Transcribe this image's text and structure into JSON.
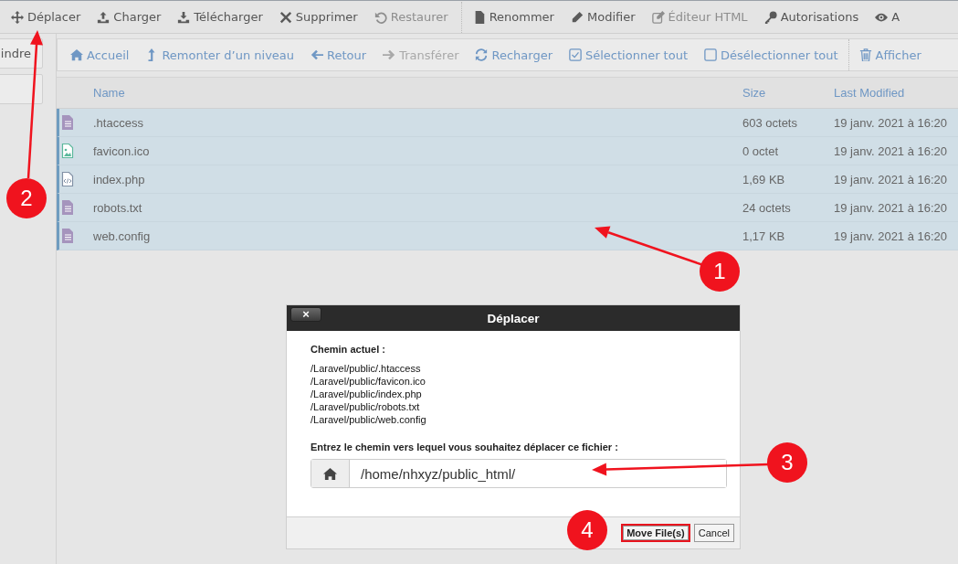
{
  "toolbar": [
    {
      "label": "Déplacer",
      "disabled": false
    },
    {
      "label": "Charger",
      "disabled": false
    },
    {
      "label": "Télécharger",
      "disabled": false
    },
    {
      "label": "Supprimer",
      "disabled": false
    },
    {
      "label": "Restaurer",
      "disabled": true
    },
    {
      "label": "Renommer",
      "disabled": false
    },
    {
      "label": "Modifier",
      "disabled": false
    },
    {
      "label": "Éditeur HTML",
      "disabled": true
    },
    {
      "label": "Autorisations",
      "disabled": false
    },
    {
      "label": "A",
      "disabled": false
    }
  ],
  "sidebar": {
    "buttons": [
      "indre"
    ]
  },
  "nav_toolbar": [
    {
      "label": "Accueil",
      "disabled": false
    },
    {
      "label": "Remonter d’un niveau",
      "disabled": false
    },
    {
      "label": "Retour",
      "disabled": false
    },
    {
      "label": "Transférer",
      "disabled": true
    },
    {
      "label": "Recharger",
      "disabled": false
    },
    {
      "label": "Sélectionner tout",
      "disabled": false
    },
    {
      "label": "Désélectionner tout",
      "disabled": false
    },
    {
      "label": "Afficher",
      "disabled": false
    }
  ],
  "table": {
    "columns": [
      "Name",
      "Size",
      "Last Modified"
    ],
    "rows": [
      {
        "kind": "text",
        "name": ".htaccess",
        "size": "603 octets",
        "modified": "19 janv. 2021 à 16:20",
        "selected": true
      },
      {
        "kind": "image",
        "name": "favicon.ico",
        "size": "0 octet",
        "modified": "19 janv. 2021 à 16:20",
        "selected": true
      },
      {
        "kind": "code",
        "name": "index.php",
        "size": "1,69 KB",
        "modified": "19 janv. 2021 à 16:20",
        "selected": true
      },
      {
        "kind": "text",
        "name": "robots.txt",
        "size": "24 octets",
        "modified": "19 janv. 2021 à 16:20",
        "selected": true
      },
      {
        "kind": "text",
        "name": "web.config",
        "size": "1,17 KB",
        "modified": "19 janv. 2021 à 16:20",
        "selected": true
      }
    ]
  },
  "dialog": {
    "title": "Déplacer",
    "close": "×",
    "current_label": "Chemin actuel :",
    "paths": [
      "/Laravel/public/.htaccess",
      "/Laravel/public/favicon.ico",
      "/Laravel/public/index.php",
      "/Laravel/public/robots.txt",
      "/Laravel/public/web.config"
    ],
    "target_label": "Entrez le chemin vers lequel vous souhaitez déplacer ce fichier :",
    "target_value": "/home/nhxyz/public_html/",
    "buttons": [
      {
        "label": "Move File(s)",
        "primary": true,
        "highlighted": true
      },
      {
        "label": "Cancel",
        "primary": false,
        "highlighted": false
      }
    ]
  },
  "annotations": [
    {
      "label": "1"
    },
    {
      "label": "2"
    },
    {
      "label": "3"
    },
    {
      "label": "4"
    }
  ]
}
